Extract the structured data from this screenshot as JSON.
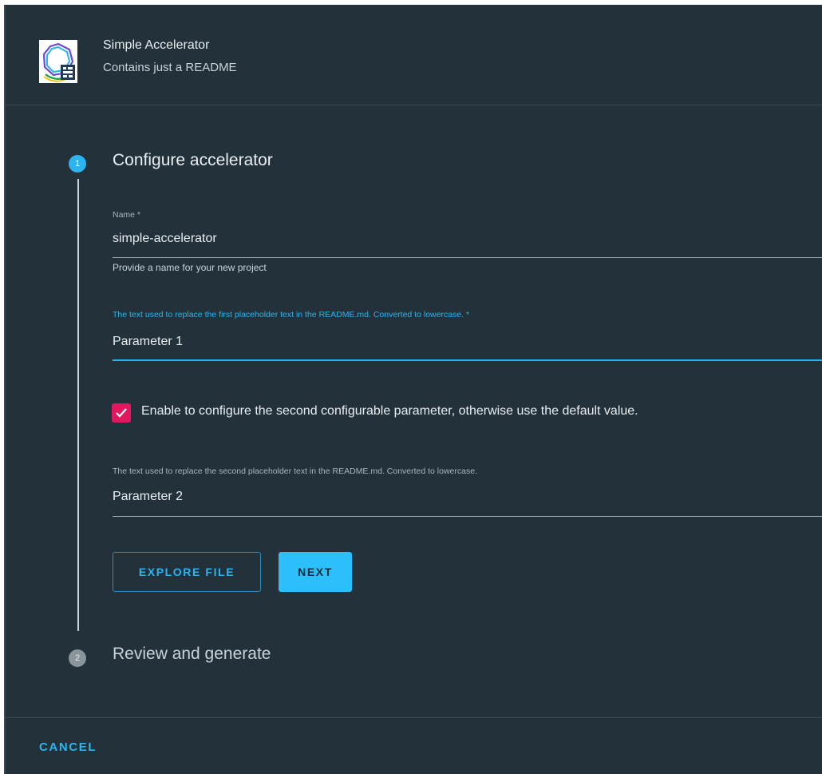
{
  "header": {
    "title": "Simple Accelerator",
    "subtitle": "Contains just a README",
    "logo_icon": "accelerator-logo-icon"
  },
  "steps": [
    {
      "number": "1",
      "title": "Configure accelerator",
      "state": "active"
    },
    {
      "number": "2",
      "title": "Review and generate",
      "state": "inactive"
    }
  ],
  "form": {
    "name": {
      "label": "Name *",
      "value": "simple-accelerator",
      "helper": "Provide a name for your new project"
    },
    "param1": {
      "label": "The text used to replace the first placeholder text in the README.md. Converted to lowercase. *",
      "value": "Parameter 1"
    },
    "enable_second": {
      "label": "Enable to configure the second configurable parameter, otherwise use the default value.",
      "checked": true
    },
    "param2": {
      "label": "The text used to replace the second placeholder text in the README.md. Converted to lowercase.",
      "value": "Parameter 2"
    }
  },
  "buttons": {
    "explore_file": "EXPLORE FILE",
    "next": "NEXT"
  },
  "footer": {
    "cancel": "CANCEL"
  },
  "colors": {
    "background": "#22313a",
    "accent": "#2bb4f0",
    "checkbox": "#e0185f",
    "text": "#e9eef1"
  }
}
